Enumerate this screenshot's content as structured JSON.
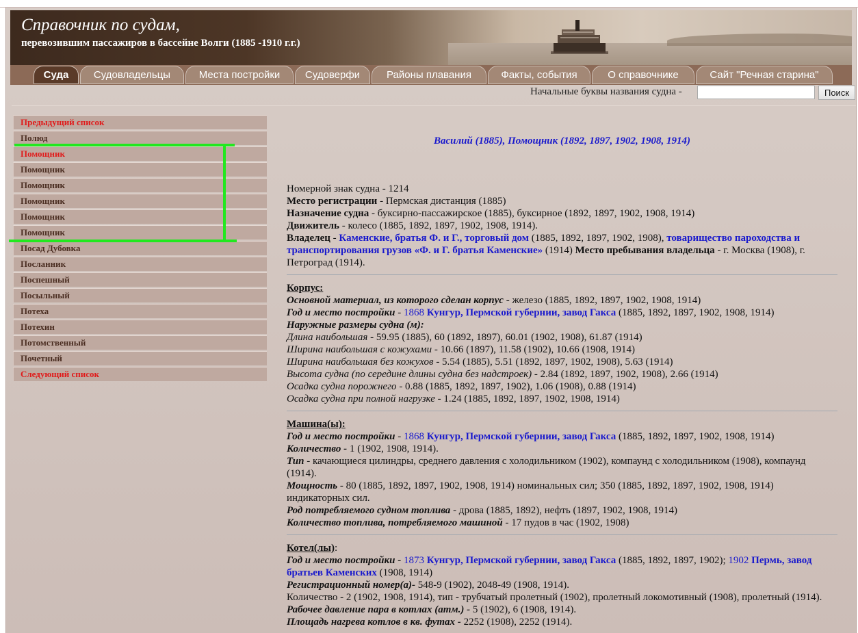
{
  "header": {
    "title": "Справочник по судам,",
    "subtitle": "перевозившим пассажиров в бассейне Волги (1885 -1910 г.г.)"
  },
  "nav": [
    {
      "label": "Суда",
      "active": true
    },
    {
      "label": "Судовладельцы"
    },
    {
      "label": "Места постройки"
    },
    {
      "label": "Судоверфи"
    },
    {
      "label": "Районы плавания"
    },
    {
      "label": "Факты, события"
    },
    {
      "label": "О справочнике"
    },
    {
      "label": "Сайт \"Речная старина\""
    }
  ],
  "search": {
    "label": "Начальные буквы названия судна -",
    "value": "",
    "button": "Поиск"
  },
  "sidebar": [
    {
      "label": "Предыдущий список",
      "red": true
    },
    {
      "label": "Полюд"
    },
    {
      "label": "Помощник",
      "red": true
    },
    {
      "label": "Помощник"
    },
    {
      "label": "Помощник"
    },
    {
      "label": "Помощник"
    },
    {
      "label": "Помощник"
    },
    {
      "label": "Помощник"
    },
    {
      "label": "Посад Дубовка"
    },
    {
      "label": "Посланник"
    },
    {
      "label": "Поспешный"
    },
    {
      "label": "Посыльный"
    },
    {
      "label": "Потеха"
    },
    {
      "label": "Потехин"
    },
    {
      "label": "Потомственный"
    },
    {
      "label": "Почетный"
    },
    {
      "label": "Следующий список",
      "red": true
    }
  ],
  "vessel": {
    "title": "Василий (1885), Помощник (1892, 1897, 1902, 1908, 1914)",
    "general": {
      "number": "Номерной знак судна - 1214",
      "reg_label": "Место регистрации",
      "reg_value": " - Пермская дистанция (1885)",
      "purpose_label": "Назначение судна",
      "purpose_value": " - буксирно-пассажирское (1885), буксирное (1892, 1897, 1902, 1908, 1914)",
      "engine_label": "Движитель",
      "engine_value": " - колесо (1885, 1892, 1897, 1902, 1908, 1914).",
      "owner_label": "Владелец",
      "owner_sep": " - ",
      "owner_link1": "Каменские, братья Ф. и Г., торговый дом",
      "owner_years1": " (1885, 1892, 1897, 1902, 1908), ",
      "owner_link2": "товарищество пароходства и транспортирования грузов «Ф. и Г. братья Каменские»",
      "owner_years2": " (1914) ",
      "owner_loc_label": "Место пребывания владельца",
      "owner_loc_value": " - г. Москва (1908), г. Петроград (1914)."
    },
    "hull": {
      "title": "Корпус:",
      "material_label": "Основной материал, из которого сделан корпус",
      "material_value": " - железо (1885, 1892, 1897, 1902, 1908, 1914)",
      "built_label": "Год и место постройки",
      "built_sep": " - ",
      "built_year": "1868",
      "built_place": " Кунгур, Пермской губернии, завод Гакса",
      "built_years": " (1885, 1892, 1897, 1902, 1908, 1914)",
      "dims_label": "Наружные размеры судна (м):",
      "dims": [
        {
          "label": "Длина наибольшая",
          "value": " - 59.95 (1885), 60 (1892, 1897), 60.01 (1902, 1908), 61.87 (1914)"
        },
        {
          "label": "Ширина наибольшая с кожухами",
          "value": " - 10.66 (1897), 11.58 (1902), 10.66 (1908, 1914)"
        },
        {
          "label": "Ширина наибольшая без кожухов",
          "value": " - 5.54 (1885), 5.51 (1892, 1897, 1902, 1908), 5.63 (1914)"
        },
        {
          "label": "Высота судна (по середине длины судна без надстроек)",
          "value": " - 2.84 (1892, 1897, 1902, 1908), 2.66 (1914)"
        },
        {
          "label": "Осадка судна порожнего",
          "value": " - 0.88 (1885, 1892, 1897, 1902), 1.06 (1908), 0.88 (1914)"
        },
        {
          "label": "Осадка судна при полной нагрузке",
          "value": " - 1.24 (1885, 1892, 1897, 1902, 1908, 1914)"
        }
      ]
    },
    "machine": {
      "title": "Машина(ы):",
      "built_label": "Год и место постройки",
      "built_sep": " - ",
      "built_year": "1868",
      "built_place": " Кунгур, Пермской губернии, завод Гакса",
      "built_years": " (1885, 1892, 1897, 1902, 1908, 1914)",
      "qty_label": "Количество - ",
      "qty_value": "1 (1902, 1908, 1914).",
      "type_label": "Тип",
      "type_value": " - качающиеся цилиндры, среднего давления с холодильником (1902), компаунд с холодильником (1908), компаунд (1914).",
      "power_label": "Мощность",
      "power_value": " - 80 (1885, 1892, 1897, 1902, 1908, 1914) номинальных сил; 350 (1885, 1892, 1897, 1902, 1908, 1914) индикаторных сил.",
      "fuel_label": "Род потребляемого судном топлива",
      "fuel_value": " - дрова (1885, 1892), нефть (1897, 1902, 1908, 1914)",
      "consumption_label": "Количество топлива, потребляемого машиной",
      "consumption_value": " - 17 пудов в час (1902, 1908)"
    },
    "boiler": {
      "title": "Котел(лы)",
      "title_suffix": ":",
      "built_label": "Год и место постройки -",
      "built_year1": " 1873",
      "built_place1": " Кунгур, Пермской губернии, завод Гакса",
      "built_years1": " (1885, 1892, 1897, 1902); ",
      "built_year2": "1902",
      "built_place2": " Пермь, завод братьев Каменских",
      "built_years2": " (1908, 1914)",
      "reg_label": "Регистрационный номер(а)-",
      "reg_value": " 548-9 (1902), 2048-49 (1908, 1914).",
      "qty_text": "Количество - 2 (1902, 1908, 1914), тип - трубчатый пролетный (1902), пролетный локомотивный (1908), пролетный (1914).",
      "pressure_label": "Рабочее давление пара в котлах (атм.) -",
      "pressure_value": " 5 (1902), 6 (1908, 1914).",
      "area_label": "Площадь нагрева котлов в кв. футах -",
      "area_value": " 2252 (1908), 2252 (1914)."
    }
  }
}
